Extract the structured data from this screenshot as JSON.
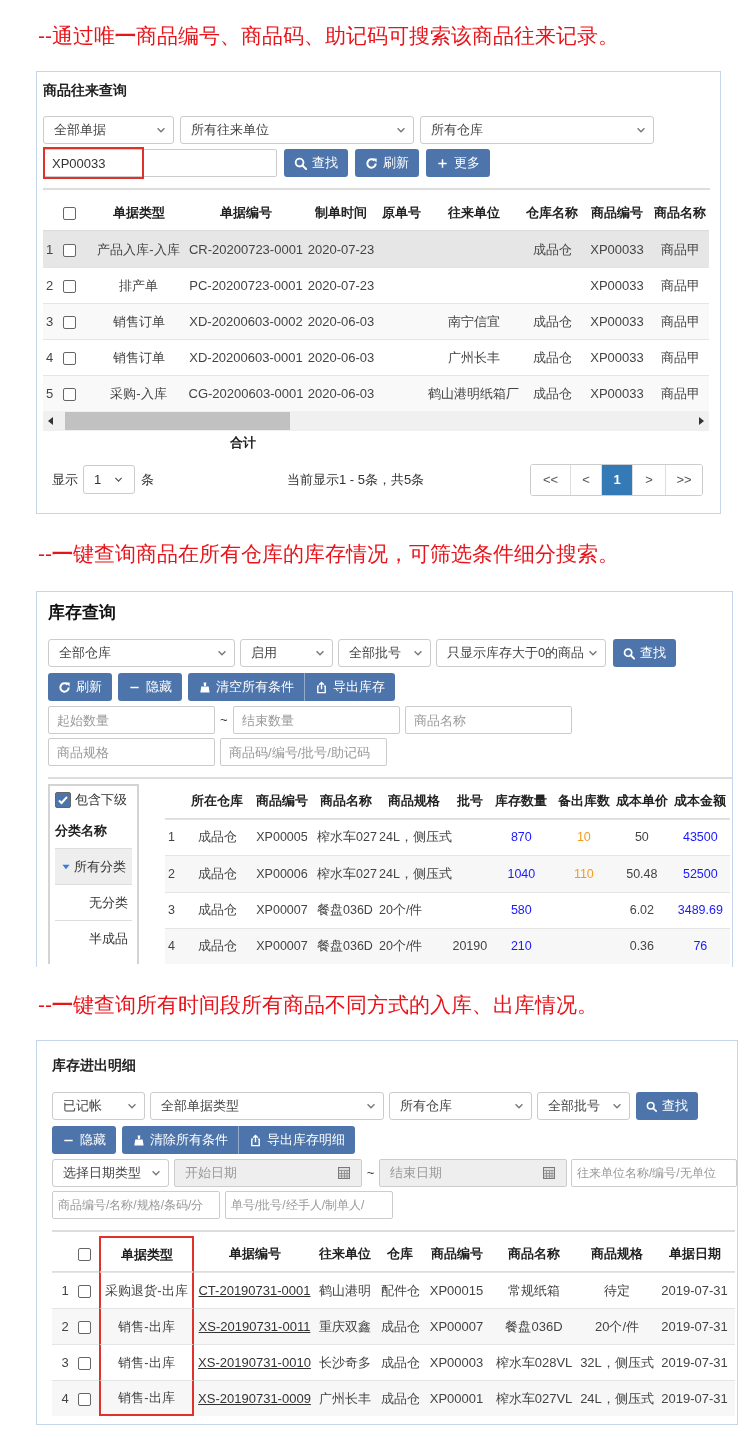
{
  "goods_history": {
    "caption": "--通过唯**一**商品编号、商品码、助记码可搜索该商品往来记录。",
    "title": "商品往来查询",
    "filters": [
      "全部单据",
      "所有往来单位",
      "所有仓库"
    ],
    "search": {
      "value": "XP00033",
      "highlighted": true
    },
    "buttons": [
      {
        "label": "查找"
      },
      {
        "label": "刷新"
      },
      {
        "label": "更多"
      }
    ],
    "select_all_checked": false,
    "columns": [
      "单据类型",
      "单据编号",
      "制单时间",
      "原单号",
      "往来单位",
      "仓库名称",
      "商品编号",
      "商品名称"
    ],
    "rows": [
      {
        "number": "1",
        "selected": true,
        "checked": false,
        "cells": [
          "产品入库-入库",
          "CR-20200723-0001",
          "2020-07-23",
          null,
          null,
          "成品仓",
          "XP00033",
          "商品甲"
        ]
      },
      {
        "number": "2",
        "selected": false,
        "checked": false,
        "cells": [
          "排产单",
          "PC-20200723-0001",
          "2020-07-23",
          null,
          null,
          null,
          "XP00033",
          "商品甲"
        ]
      },
      {
        "number": "3",
        "selected": false,
        "checked": false,
        "cells": [
          "销售订单",
          "XD-20200603-0002",
          "2020-06-03",
          null,
          "南宁信宜",
          "成品仓",
          "XP00033",
          "商品甲"
        ]
      },
      {
        "number": "4",
        "selected": false,
        "checked": false,
        "cells": [
          "销售订单",
          "XD-20200603-0001",
          "2020-06-03",
          null,
          "广州长丰",
          "成品仓",
          "XP00033",
          "商品甲"
        ]
      },
      {
        "number": "5",
        "selected": false,
        "checked": false,
        "cells": [
          "采购-入库",
          "CG-20200603-0001",
          "2020-06-03",
          null,
          "鹤山港明纸箱厂",
          "成品仓",
          "XP00033",
          "商品甲"
        ]
      }
    ],
    "total_label": "合计",
    "page_size": {
      "prefix": "显示",
      "value": "1",
      "suffix": "条"
    },
    "summary": "当前显示1 - 5条，共5条",
    "pages": [
      {
        "label": "<<",
        "selected": false
      },
      {
        "label": "<",
        "selected": false
      },
      {
        "label": "1",
        "selected": true
      },
      {
        "label": ">",
        "selected": false
      },
      {
        "label": ">>",
        "selected": false
      }
    ]
  },
  "stock_query": {
    "caption": "--**一**键查询商品在所有仓库的库存情况，可筛选条件细分搜索。",
    "title": "库存查询",
    "filters": [
      "全部仓库",
      "启用",
      "全部批号",
      "只显示库存大于0的商品"
    ],
    "search_button": {
      "label": "查找"
    },
    "buttons": [
      {
        "label": "刷新",
        "kind": "single"
      },
      {
        "label": "隐藏",
        "kind": "single"
      },
      {
        "label": "清空所有条件",
        "kind": "grouped"
      },
      {
        "label": "导出库存",
        "kind": "grouped"
      }
    ],
    "range": [
      {
        "placeholder": "起始数量"
      },
      {
        "placeholder": "结束数量"
      }
    ],
    "range_separator": "~",
    "fields": [
      {
        "placeholder": "商品名称"
      },
      {
        "placeholder": "商品规格"
      },
      {
        "placeholder": "商品码/编号/批号/助记码"
      }
    ],
    "tree": {
      "include_children": {
        "label": "包含下级",
        "checked": true
      },
      "header": "分类名称",
      "items": [
        {
          "label": "所有分类",
          "expanded": true,
          "selected": true,
          "children": [
            {
              "label": "无分类",
              "selected": false
            },
            {
              "label": "半成品",
              "selected": false
            }
          ]
        }
      ]
    },
    "columns": [
      "所在仓库",
      "商品编号",
      "商品名称",
      "商品规格",
      "批号",
      "库存数量",
      "备出库数",
      "成本单价",
      "成本金额"
    ],
    "rows": [
      {
        "number": "1",
        "cells": [
          "成品仓",
          "XP00005",
          "榨水车027",
          "24L，侧压式",
          null,
          "870",
          "10",
          "50",
          "43500"
        ]
      },
      {
        "number": "2",
        "cells": [
          "成品仓",
          "XP00006",
          "榨水车027",
          "24L，侧压式",
          null,
          "1040",
          "110",
          "50.48",
          "52500"
        ]
      },
      {
        "number": "3",
        "cells": [
          "成品仓",
          "XP00007",
          "餐盘036D",
          "20个/件",
          null,
          "580",
          null,
          "6.02",
          "3489.69"
        ]
      },
      {
        "number": "4",
        "cells": [
          "成品仓",
          "XP00007",
          "餐盘036D",
          "20个/件",
          "20190",
          "210",
          null,
          "0.36",
          "76"
        ]
      }
    ]
  },
  "stock_detail": {
    "caption": "--**一**键查询所有时间段所有商品不同方式的入库、出库情况。",
    "title": "库存进出明细",
    "filters": [
      "已记帐",
      "全部单据类型",
      "所有仓库",
      "全部批号"
    ],
    "search_button": {
      "label": "查找"
    },
    "buttons": [
      {
        "label": "隐藏",
        "kind": "single"
      },
      {
        "label": "清除所有条件",
        "kind": "grouped"
      },
      {
        "label": "导出库存明细",
        "kind": "grouped"
      }
    ],
    "date_type": "选择日期类型",
    "date_range": {
      "from": "开始日期",
      "separator": "~",
      "to": "结束日期",
      "disabled": true
    },
    "fields": [
      {
        "placeholder": "往来单位名称/编号/无单位"
      },
      {
        "placeholder": "商品编号/名称/规格/条码/分"
      },
      {
        "placeholder": "单号/批号/经手人/制单人/"
      }
    ],
    "select_all_checked": false,
    "columns": [
      {
        "label": "单据类型",
        "highlighted": true
      },
      {
        "label": "单据编号",
        "highlighted": false
      },
      {
        "label": "往来单位",
        "highlighted": false
      },
      {
        "label": "仓库",
        "highlighted": false
      },
      {
        "label": "商品编号",
        "highlighted": false
      },
      {
        "label": "商品名称",
        "highlighted": false
      },
      {
        "label": "商品规格",
        "highlighted": false
      },
      {
        "label": "单据日期",
        "highlighted": false
      }
    ],
    "rows": [
      {
        "number": "1",
        "checked": false,
        "cells": [
          "采购退货-出库",
          "CT-20190731-0001",
          "鹤山港明",
          "配件仓",
          "XP00015",
          "常规纸箱",
          "待定",
          "2019-07-31"
        ]
      },
      {
        "number": "2",
        "checked": false,
        "cells": [
          "销售-出库",
          "XS-20190731-0011",
          "重庆双鑫",
          "成品仓",
          "XP00007",
          "餐盘036D",
          "20个/件",
          "2019-07-31"
        ]
      },
      {
        "number": "3",
        "checked": false,
        "cells": [
          "销售-出库",
          "XS-20190731-0010",
          "长沙奇多",
          "成品仓",
          "XP00003",
          "榨水车028VL",
          "32L，侧压式",
          "2019-07-31"
        ]
      },
      {
        "number": "4",
        "checked": false,
        "cells": [
          "销售-出库",
          "XS-20190731-0009",
          "广州长丰",
          "成品仓",
          "XP00001",
          "榨水车027VL",
          "24L，侧压式",
          "2019-07-31"
        ]
      }
    ]
  }
}
